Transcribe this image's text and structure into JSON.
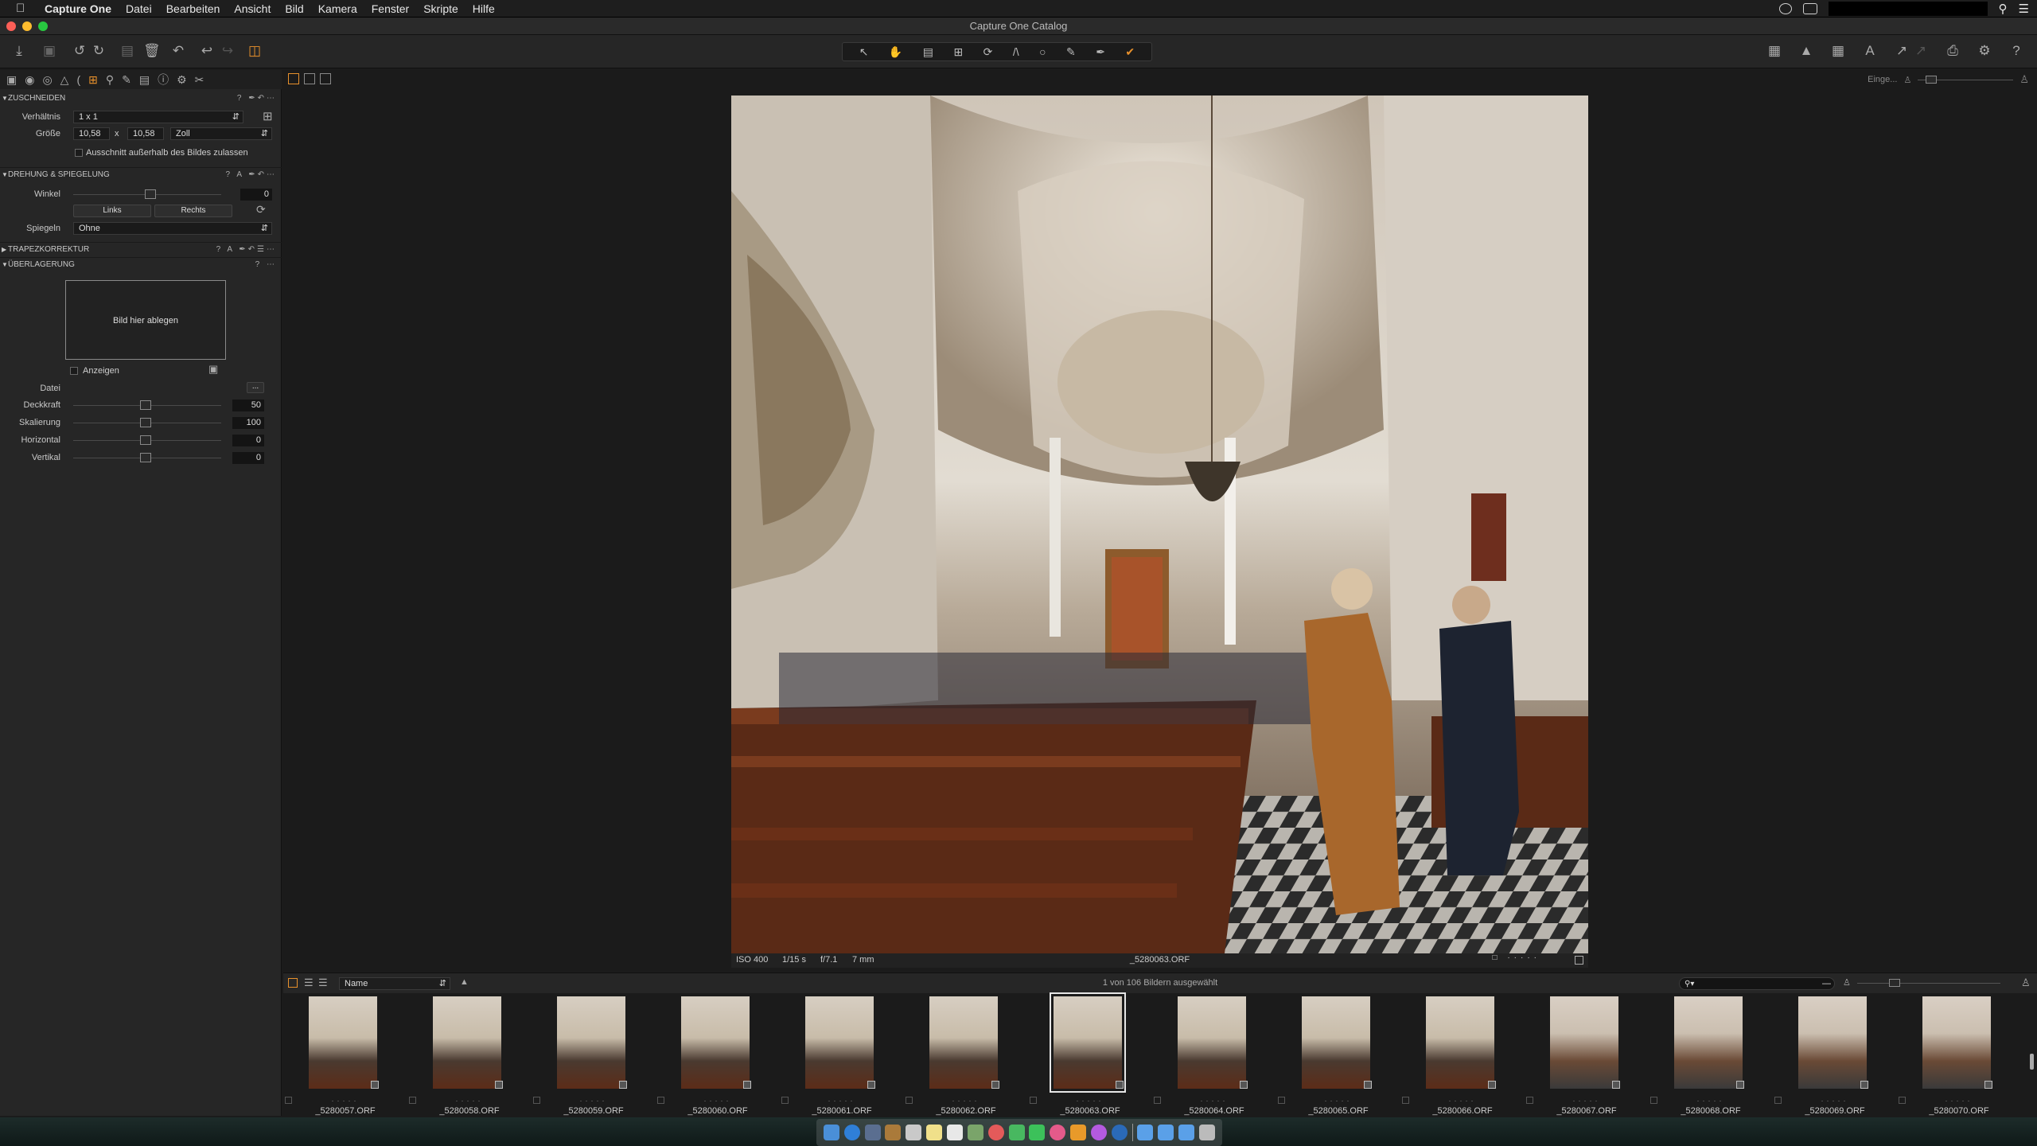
{
  "menubar": {
    "apple": "",
    "items": [
      "Capture One",
      "Datei",
      "Bearbeiten",
      "Ansicht",
      "Bild",
      "Kamera",
      "Fenster",
      "Skripte",
      "Hilfe"
    ]
  },
  "window": {
    "title": "Capture One Catalog"
  },
  "topright": {
    "label": "Einge..."
  },
  "crop": {
    "header": "ZUSCHNEIDEN",
    "ratio_label": "Verhältnis",
    "ratio_value": "1 x 1",
    "size_label": "Größe",
    "width": "10,58",
    "x_sep": "x",
    "height": "10,58",
    "unit": "Zoll",
    "outside_label": "Ausschnitt außerhalb des Bildes zulassen"
  },
  "rotation": {
    "header": "DREHUNG & SPIEGELUNG",
    "angle_label": "Winkel",
    "angle_value": "0",
    "left_btn": "Links",
    "right_btn": "Rechts",
    "mirror_label": "Spiegeln",
    "mirror_value": "Ohne"
  },
  "keystone": {
    "header": "TRAPEZKORREKTUR"
  },
  "overlay": {
    "header": "ÜBERLAGERUNG",
    "drop_text": "Bild hier ablegen",
    "show_label": "Anzeigen",
    "file_label": "Datei",
    "file_btn": "...",
    "opacity_label": "Deckkraft",
    "opacity_value": "50",
    "scale_label": "Skalierung",
    "scale_value": "100",
    "horizontal_label": "Horizontal",
    "horizontal_value": "0",
    "vertical_label": "Vertikal",
    "vertical_value": "0"
  },
  "viewer": {
    "iso": "ISO 400",
    "shutter": "1/15 s",
    "aperture": "f/7.1",
    "focal": "7 mm",
    "filename": "_5280063.ORF"
  },
  "browser": {
    "sort_value": "Name",
    "status": "1 von 106 Bildern ausgewählt",
    "search_placeholder": "",
    "thumbnails": [
      {
        "name": "_5280057.ORF",
        "kind": "side"
      },
      {
        "name": "_5280058.ORF",
        "kind": "side"
      },
      {
        "name": "_5280059.ORF",
        "kind": "side"
      },
      {
        "name": "_5280060.ORF",
        "kind": "side"
      },
      {
        "name": "_5280061.ORF",
        "kind": "side"
      },
      {
        "name": "_5280062.ORF",
        "kind": "side"
      },
      {
        "name": "_5280063.ORF",
        "kind": "side",
        "selected": true
      },
      {
        "name": "_5280064.ORF",
        "kind": "side"
      },
      {
        "name": "_5280065.ORF",
        "kind": "side"
      },
      {
        "name": "_5280066.ORF",
        "kind": "side"
      },
      {
        "name": "_5280067.ORF",
        "kind": "nave"
      },
      {
        "name": "_5280068.ORF",
        "kind": "nave"
      },
      {
        "name": "_5280069.ORF",
        "kind": "nave"
      },
      {
        "name": "_5280070.ORF",
        "kind": "nave"
      }
    ]
  },
  "colors": {
    "accent": "#e8912c",
    "panel": "#262626",
    "viewer_bg": "#1b1b1b"
  }
}
